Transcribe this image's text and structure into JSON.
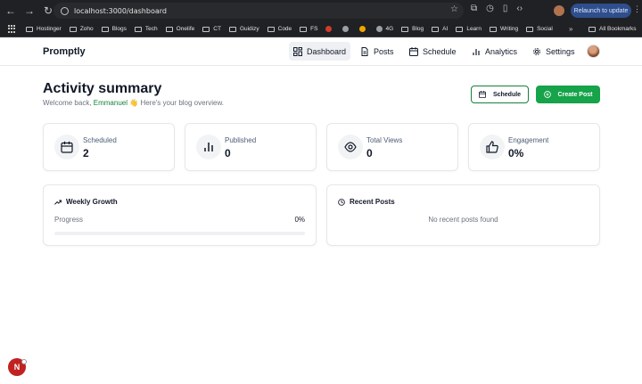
{
  "browser": {
    "url": "localhost:3000/dashboard",
    "relaunch_label": "Relaunch to update",
    "bookmarks": [
      "Hostinger",
      "Zoho",
      "Blogs",
      "Tech",
      "Onelife",
      "CT",
      "Guidizy",
      "Code",
      "FS",
      "4G",
      "Blog",
      "AI",
      "Learn",
      "Writing",
      "Social"
    ],
    "all_bookmarks_label": "All Bookmarks"
  },
  "nav": {
    "brand": "Promptly",
    "items": [
      {
        "label": "Dashboard",
        "icon": "grid-icon",
        "active": true
      },
      {
        "label": "Posts",
        "icon": "document-icon",
        "active": false
      },
      {
        "label": "Schedule",
        "icon": "calendar-icon",
        "active": false
      },
      {
        "label": "Analytics",
        "icon": "bar-chart-icon",
        "active": false
      },
      {
        "label": "Settings",
        "icon": "gear-icon",
        "active": false
      }
    ]
  },
  "header": {
    "title": "Activity summary",
    "welcome_prefix": "Welcome back, ",
    "user_name": "Emmanuel",
    "welcome_suffix": " Here's your blog overview.",
    "emoji": "👋",
    "schedule_button": "Schedule",
    "create_button": "Create Post"
  },
  "stats": [
    {
      "label": "Scheduled",
      "value": "2",
      "icon": "calendar-icon"
    },
    {
      "label": "Published",
      "value": "0",
      "icon": "bar-chart-icon"
    },
    {
      "label": "Total Views",
      "value": "0",
      "icon": "eye-icon"
    },
    {
      "label": "Engagement",
      "value": "0%",
      "icon": "thumbs-up-icon"
    }
  ],
  "weekly_growth": {
    "title": "Weekly Growth",
    "progress_label": "Progress",
    "progress_text": "0%",
    "progress_value": 0
  },
  "recent_posts": {
    "title": "Recent Posts",
    "empty_text": "No recent posts found"
  },
  "dev_badge": "N",
  "colors": {
    "accent": "#16a34a",
    "accent_text": "#16803c",
    "chrome_bg": "#202124"
  }
}
